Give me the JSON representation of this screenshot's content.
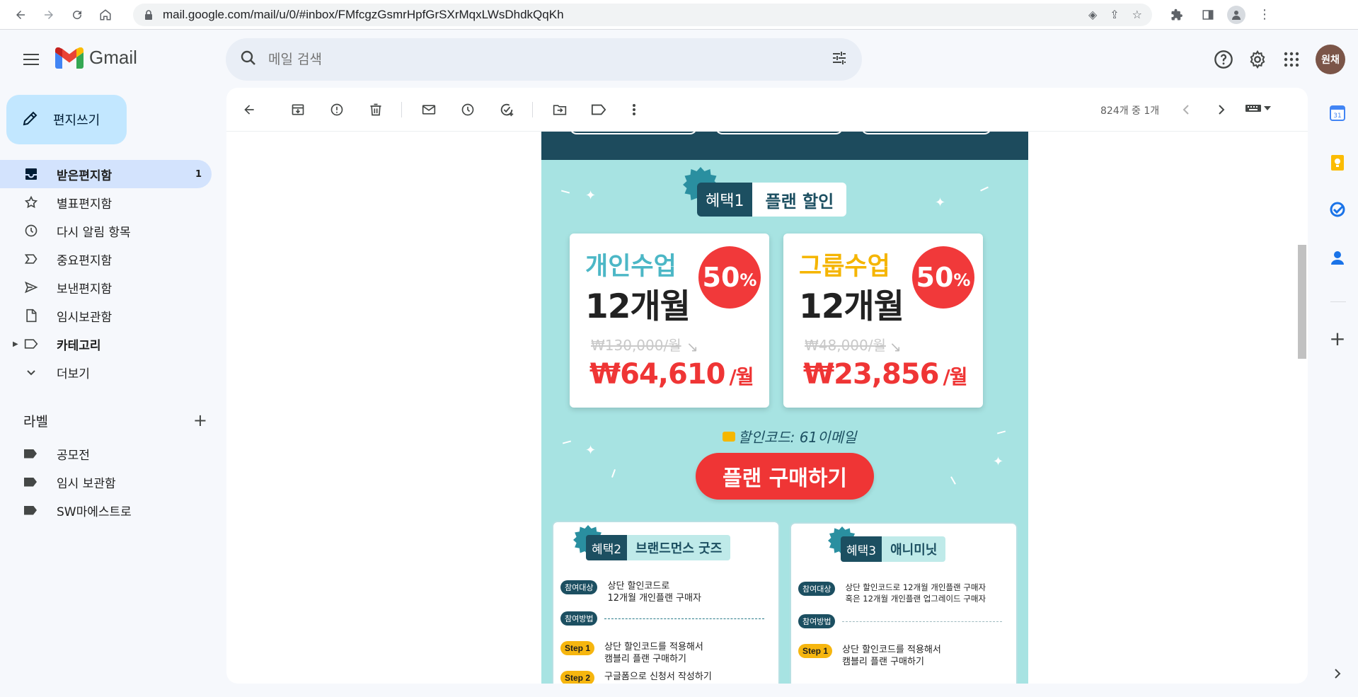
{
  "browser": {
    "url": "mail.google.com/mail/u/0/#inbox/FMfcgzGsmrHpfGrSXrMqxLWsDhdkQqKh"
  },
  "app": {
    "name": "Gmail",
    "search_placeholder": "메일 검색",
    "avatar_text": "원채"
  },
  "compose_label": "편지쓰기",
  "nav": [
    {
      "label": "받은편지함",
      "count": "1",
      "icon": "inbox-icon"
    },
    {
      "label": "별표편지함",
      "icon": "star-icon"
    },
    {
      "label": "다시 알림 항목",
      "icon": "clock-icon"
    },
    {
      "label": "중요편지함",
      "icon": "important-icon"
    },
    {
      "label": "보낸편지함",
      "icon": "send-icon"
    },
    {
      "label": "임시보관함",
      "icon": "draft-icon"
    },
    {
      "label": "카테고리",
      "icon": "label-icon"
    },
    {
      "label": "더보기",
      "icon": "chevron-down-icon"
    }
  ],
  "labels": {
    "heading": "라벨",
    "items": [
      "공모전",
      "임시 보관함",
      "SW마에스트로"
    ]
  },
  "toolbar": {
    "pager_text": "824개 중 1개"
  },
  "email": {
    "benefit1": {
      "tag": "혜택1",
      "title": "플랜 할인"
    },
    "cards": [
      {
        "category": "개인수업",
        "months": "12개월",
        "discount": "50",
        "percent": "%",
        "old_price": "₩130,000/월",
        "new_price": "₩64,610",
        "per": "/월",
        "color": "#4cb7c6"
      },
      {
        "category": "그룹수업",
        "months": "12개월",
        "discount": "50",
        "percent": "%",
        "old_price": "₩48,000/월",
        "new_price": "₩23,856",
        "per": "/월",
        "color": "#f5b500"
      }
    ],
    "coupon": "할인코드: 61이메일",
    "cta": "플랜 구매하기",
    "benefit2": {
      "tag": "혜택2",
      "title": "브랜드먼스 굿즈",
      "target_tag": "참여대상",
      "target_text": "상단 할인코드로\n12개월 개인플랜 구매자",
      "method_tag": "참여방법",
      "step1_tag": "Step 1",
      "step1_text": "상단 할인코드를 적용해서\n캠블리 플랜 구매하기",
      "step2_tag": "Step 2",
      "step2_text": "구글폼으로 신청서 작성하기"
    },
    "benefit3": {
      "tag": "혜택3",
      "title": "애니미닛",
      "target_tag": "참여대상",
      "target_text": "상단 할인코드로 12개월 개인플랜 구매자\n혹은 12개월 개인플랜 업그레이드 구매자",
      "method_tag": "참여방법",
      "step1_tag": "Step 1",
      "step1_text": "상단 할인코드를 적용해서\n캠블리 플랜 구매하기"
    }
  },
  "colors": {
    "accent": "#ef3535",
    "teal_dark": "#1c4f61",
    "mint_bg": "#a7e3e2",
    "nav_active": "#d3e3fd",
    "compose_bg": "#c2e7ff"
  }
}
